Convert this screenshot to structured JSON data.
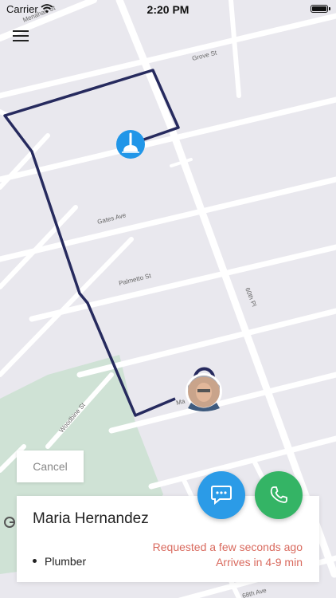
{
  "status_bar": {
    "carrier": "Carrier",
    "time": "2:20 PM",
    "wifi_icon": "wifi-icon",
    "battery_icon": "battery-icon"
  },
  "menu": {
    "icon": "hamburger-menu-icon"
  },
  "map": {
    "street_labels": [
      "Menahan St",
      "Grove St",
      "Gates Ave",
      "Palmetto St",
      "60th Pl",
      "Woodbine St",
      "68th Ave",
      "Ma"
    ],
    "route_color": "#262a5e",
    "origin_marker_icon": "plunger-icon",
    "origin_marker_color": "#2196e8",
    "destination_marker": "user-avatar"
  },
  "cancel": {
    "label": "Cancel"
  },
  "request_card": {
    "name": "Maria Hernandez",
    "service": "Plumber",
    "requested": "Requested a few seconds ago",
    "eta": "Arrives in 4-9 min",
    "status_color": "#d96a5e"
  },
  "actions": {
    "chat_icon": "chat-bubble-icon",
    "call_icon": "phone-icon",
    "chat_color": "#2b9be7",
    "call_color": "#34b465"
  }
}
